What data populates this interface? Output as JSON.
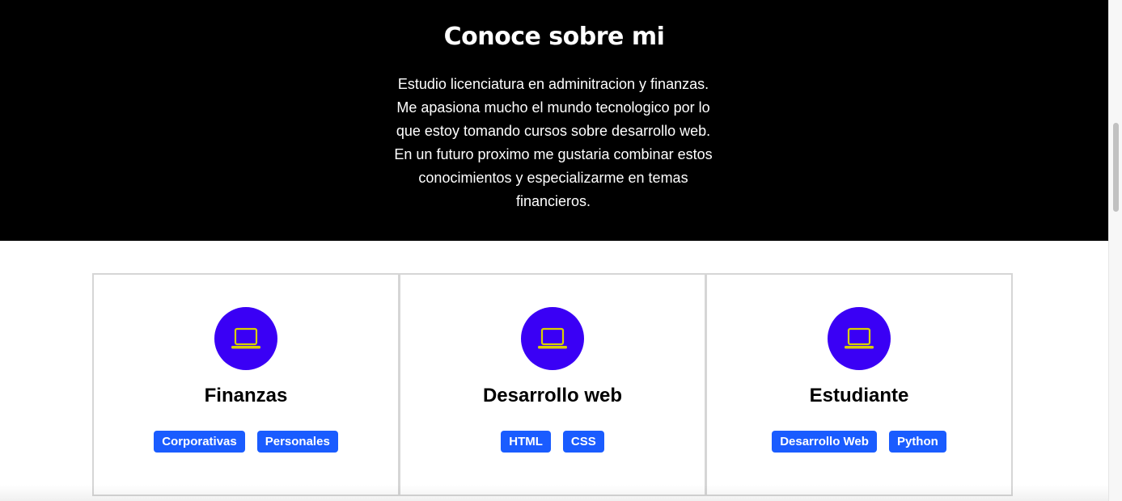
{
  "about": {
    "title": "Conoce sobre mi",
    "description": "Estudio licenciatura en adminitracion y finanzas. Me apasiona mucho el mundo tecnologico por lo que estoy tomando cursos sobre desarrollo web. En un futuro proximo me gustaria combinar estos conocimientos y especializarme en temas financieros."
  },
  "cards": [
    {
      "icon": "laptop-icon",
      "title": "Finanzas",
      "tags": [
        "Corporativas",
        "Personales"
      ]
    },
    {
      "icon": "laptop-icon",
      "title": "Desarrollo web",
      "tags": [
        "HTML",
        "CSS"
      ]
    },
    {
      "icon": "laptop-icon",
      "title": "Estudiante",
      "tags": [
        "Desarrollo Web",
        "Python"
      ]
    }
  ],
  "colors": {
    "hero_background": "#000000",
    "icon_circle": "#3a00f5",
    "icon_stroke": "#d8d000",
    "tag_background": "#1a5cff"
  }
}
